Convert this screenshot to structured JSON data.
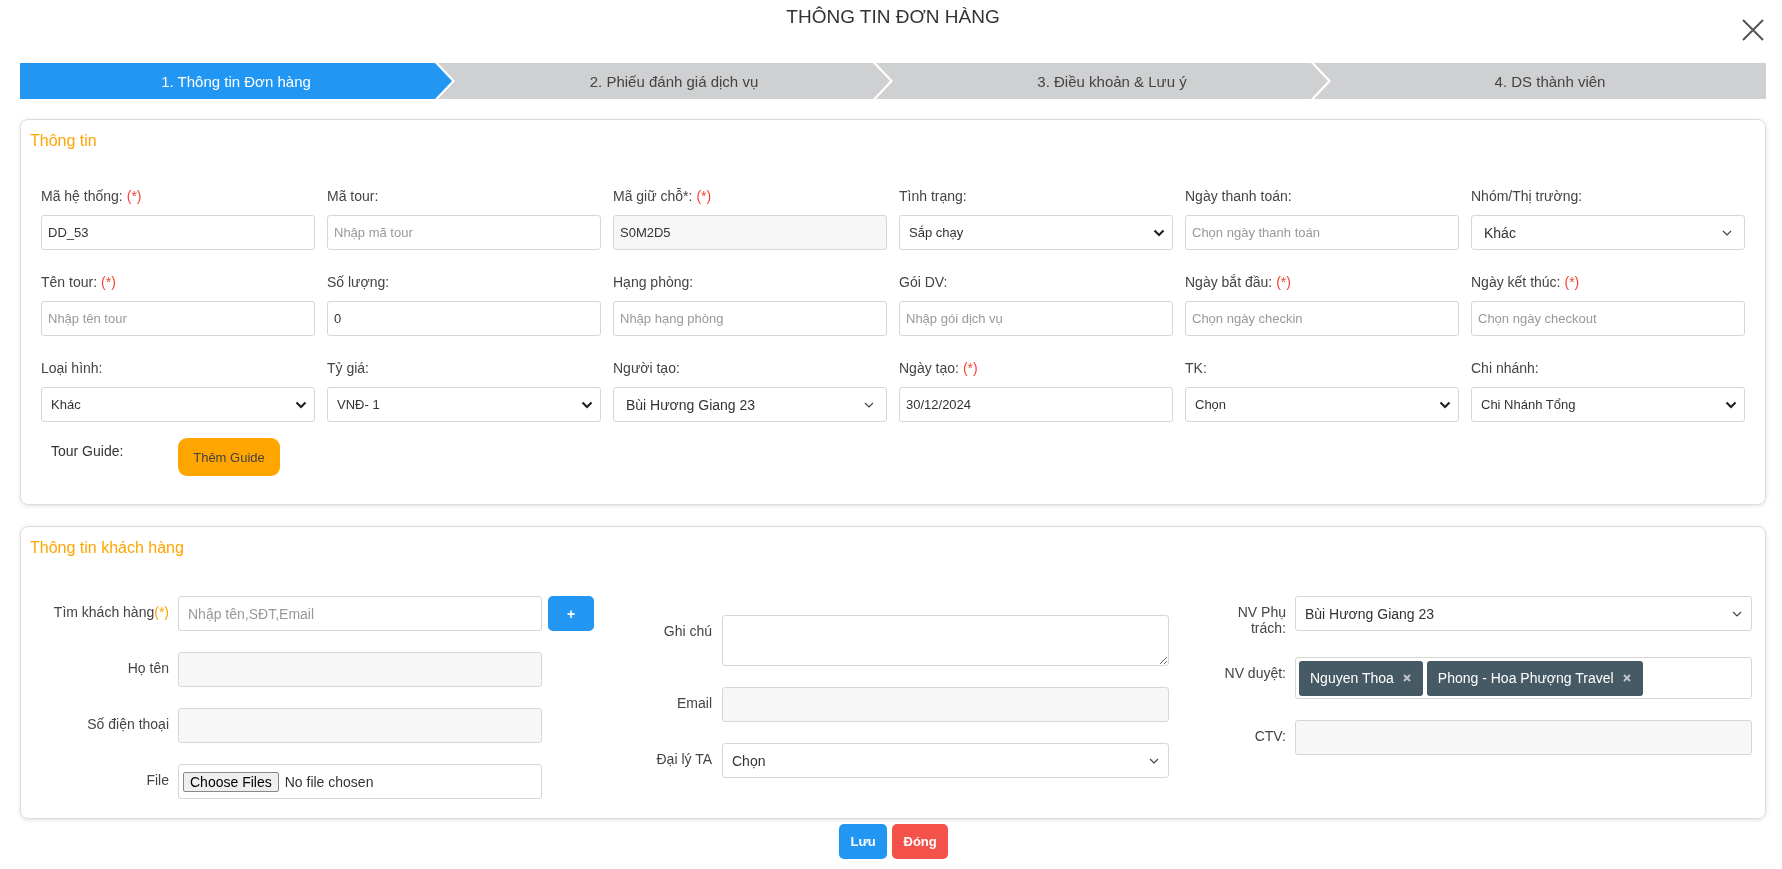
{
  "title": "THÔNG TIN ĐƠN HÀNG",
  "steps": [
    {
      "label": "1. Thông tin Đơn hàng",
      "selected": true
    },
    {
      "label": "2. Phiếu đánh giá dịch vụ",
      "selected": false
    },
    {
      "label": "3. Điều khoản & Lưu ý",
      "selected": false
    },
    {
      "label": "4. DS thành viên",
      "selected": false
    }
  ],
  "order_section": {
    "heading": "Thông tin",
    "fields": [
      {
        "label": "Mã hệ thống:",
        "required_mark": "(*)",
        "kind": "text",
        "value": "DD_53"
      },
      {
        "label": "Mã tour:",
        "kind": "text",
        "placeholder": "Nhập mã tour"
      },
      {
        "label": "Mã giữ chỗ*:",
        "required_mark": "(*)",
        "kind": "locked",
        "value": "S0M2D5"
      },
      {
        "label": "Tình trạng:",
        "kind": "select",
        "value": "Sắp chạy"
      },
      {
        "label": "Ngày thanh toán:",
        "kind": "text",
        "placeholder": "Chọn ngày thanh toán"
      },
      {
        "label": "Nhóm/Thị trường:",
        "kind": "dropdown",
        "value": "Khác"
      },
      {
        "label": "Tên tour:",
        "required_mark": "(*)",
        "kind": "text",
        "placeholder": "Nhập tên tour"
      },
      {
        "label": "Số lượng:",
        "kind": "text",
        "value": "0"
      },
      {
        "label": "Hạng phòng:",
        "kind": "text",
        "placeholder": "Nhập hạng phòng"
      },
      {
        "label": "Gói DV:",
        "kind": "text",
        "placeholder": "Nhập gói dịch vụ"
      },
      {
        "label": "Ngày bắt đầu:",
        "required_mark": "(*)",
        "kind": "text",
        "placeholder": "Chọn ngày checkin"
      },
      {
        "label": "Ngày kết thúc:",
        "required_mark": "(*)",
        "kind": "text",
        "placeholder": "Chọn ngày checkout"
      },
      {
        "label": "Loại hình:",
        "kind": "select",
        "value": "Khác"
      },
      {
        "label": "Tỷ giá:",
        "kind": "select",
        "value": "VNĐ- 1"
      },
      {
        "label": "Người tạo:",
        "kind": "dropdown",
        "value": "Bùi Hương Giang 23"
      },
      {
        "label": "Ngày tạo:",
        "required_mark": "(*)",
        "kind": "text",
        "value": "30/12/2024"
      },
      {
        "label": "TK:",
        "kind": "select",
        "value": "Chọn"
      },
      {
        "label": "Chi nhánh:",
        "kind": "select",
        "value": "Chi Nhánh Tổng"
      }
    ],
    "tour_guide": {
      "label": "Tour Guide:",
      "button": "Thêm Guide"
    }
  },
  "customer_section": {
    "heading": "Thông tin khách hàng",
    "columns": [
      [
        {
          "label": "Tìm khách hàng",
          "required_mark": "(*)",
          "kind": "search",
          "placeholder": "Nhập tên,SĐT,Email",
          "button": "+"
        },
        {
          "label": "Họ tên",
          "kind": "readonly"
        },
        {
          "label": "Số điện thoại",
          "kind": "readonly"
        },
        {
          "label": "File",
          "kind": "file",
          "button": "Choose Files",
          "value": "No file chosen"
        }
      ],
      [
        {
          "label": "Ghi chú",
          "kind": "textarea"
        },
        {
          "label": "Email",
          "kind": "readonly"
        },
        {
          "label": "Đại lý TA",
          "kind": "dropdown",
          "value": "Chọn"
        }
      ],
      [
        {
          "label": "NV Phụ trách:",
          "kind": "dropdown",
          "value": "Bùi Hương Giang 23"
        },
        {
          "label": "NV duyệt:",
          "kind": "tags",
          "tags": [
            "Nguyen Thoa",
            "Phong - Hoa Phượng Travel"
          ]
        },
        {
          "label": "CTV:",
          "kind": "readonly"
        }
      ]
    ]
  },
  "buttons": [
    {
      "label": "Lưu",
      "kind": "primary"
    },
    {
      "label": "Đóng",
      "kind": "danger"
    }
  ]
}
